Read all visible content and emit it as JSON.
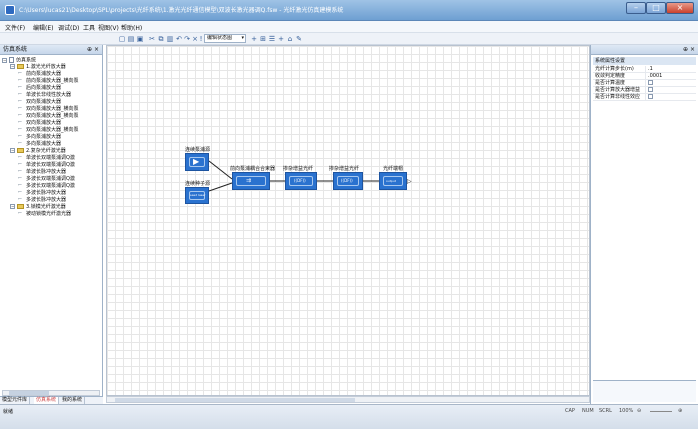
{
  "window": {
    "title": "C:\\Users\\lucas21\\Desktop\\SPL\\projects\\光纤系统\\1.激光光纤通信模型\\双波长激光器调Q.fsw - 光纤激光仿真建模系统"
  },
  "menu": {
    "items": [
      "文件(F)",
      "编辑(E)",
      "调试(D)",
      "工具",
      "视图(V)",
      "帮助(H)"
    ]
  },
  "toolbar": {
    "state_select": "编辑状态图",
    "icons": [
      "new-icon",
      "open-icon",
      "save-icon",
      "cut-icon",
      "copy-icon",
      "paste-icon",
      "undo-icon",
      "redo-icon",
      "delete-icon",
      "flag-icon",
      "settings-icon",
      "add-icon",
      "grid-icon",
      "align-icon",
      "plus-icon",
      "home-icon",
      "pen-icon"
    ]
  },
  "left_panel": {
    "title": "仿真系统",
    "tree": [
      {
        "depth": 0,
        "kind": "root",
        "label": "仿真系统"
      },
      {
        "depth": 1,
        "kind": "folder",
        "label": "1.激光光纤放大器"
      },
      {
        "depth": 2,
        "kind": "leaf",
        "label": "前向泵浦放大器"
      },
      {
        "depth": 2,
        "kind": "leaf",
        "label": "前向泵浦放大器_横向泵"
      },
      {
        "depth": 2,
        "kind": "leaf",
        "label": "后向泵浦放大器"
      },
      {
        "depth": 2,
        "kind": "leaf",
        "label": "单波长非线性放大器"
      },
      {
        "depth": 2,
        "kind": "leaf",
        "label": "双向泵浦放大器"
      },
      {
        "depth": 2,
        "kind": "leaf",
        "label": "双向泵浦放大器_横向泵"
      },
      {
        "depth": 2,
        "kind": "leaf",
        "label": "双向泵浦放大器_横向泵"
      },
      {
        "depth": 2,
        "kind": "leaf",
        "label": "双向泵浦放大器"
      },
      {
        "depth": 2,
        "kind": "leaf",
        "label": "双向泵浦放大器_横向泵"
      },
      {
        "depth": 2,
        "kind": "leaf",
        "label": "多向泵浦放大器"
      },
      {
        "depth": 2,
        "kind": "leaf",
        "label": "多向泵浦放大器"
      },
      {
        "depth": 1,
        "kind": "folder",
        "label": "2.复杂光纤激光器"
      },
      {
        "depth": 2,
        "kind": "leaf",
        "label": "单波长双端泵浦调Q激"
      },
      {
        "depth": 2,
        "kind": "leaf",
        "label": "单波长双端泵浦调Q激"
      },
      {
        "depth": 2,
        "kind": "leaf",
        "label": "单波长脉冲放大器"
      },
      {
        "depth": 2,
        "kind": "leaf",
        "label": "多波长双端泵浦调Q激"
      },
      {
        "depth": 2,
        "kind": "leaf",
        "label": "多波长双端泵浦调Q激"
      },
      {
        "depth": 2,
        "kind": "leaf",
        "label": "多波长脉冲放大器"
      },
      {
        "depth": 2,
        "kind": "leaf",
        "label": "多波长脉冲放大器"
      },
      {
        "depth": 1,
        "kind": "folder",
        "label": "3.锁模光纤激光器"
      },
      {
        "depth": 2,
        "kind": "leaf",
        "label": "被动锁模光纤激光器"
      }
    ],
    "tabs": [
      "模型元件库",
      "仿真系统",
      "我的系统"
    ],
    "active_tab": 1
  },
  "canvas": {
    "blocks": [
      {
        "id": "laser-source",
        "label": "连续泵浦源",
        "symbol": "▶"
      },
      {
        "id": "seed-source",
        "label": "连续种子源",
        "symbol": "seed laser"
      },
      {
        "id": "combiner",
        "label": "前向泵浦耦合合束器",
        "symbol": "⇉"
      },
      {
        "id": "doped-fiber",
        "label": "掺杂增益光纤",
        "symbol": "((DF))"
      },
      {
        "id": "passive-fiber",
        "label": "掺杂增益光纤",
        "symbol": "((DF))"
      },
      {
        "id": "detector",
        "label": "光纤端帽",
        "symbol": "output"
      }
    ]
  },
  "right_panel": {
    "title": "系统属性设置",
    "props": [
      {
        "key": "光纤计算步长(m)",
        "value": ".1",
        "type": "text"
      },
      {
        "key": "收敛判定精度",
        "value": ".0001",
        "type": "text"
      },
      {
        "key": "是否计算温度",
        "value": "",
        "type": "check"
      },
      {
        "key": "是否计算放大器增益",
        "value": "",
        "type": "check"
      },
      {
        "key": "是否计算非线性效应",
        "value": "",
        "type": "check"
      }
    ]
  },
  "status": {
    "text": "就绪",
    "cap": "CAP",
    "num": "NUM",
    "scrl": "SCRL",
    "zoom": "100%"
  }
}
